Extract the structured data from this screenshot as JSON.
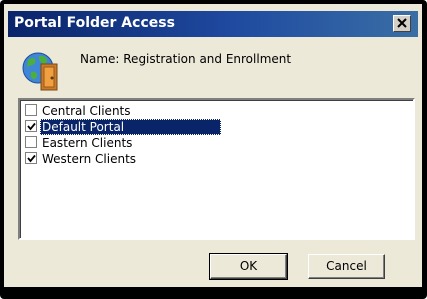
{
  "window": {
    "title": "Portal Folder Access",
    "close_glyph": "×"
  },
  "header": {
    "name_text": "Name: Registration and Enrollment",
    "icon": "globe-door-icon"
  },
  "list": {
    "items": [
      {
        "label": "Central Clients",
        "checked": false,
        "selected": false
      },
      {
        "label": "Default Portal",
        "checked": true,
        "selected": true
      },
      {
        "label": "Eastern Clients",
        "checked": false,
        "selected": false
      },
      {
        "label": "Western Clients",
        "checked": true,
        "selected": false
      }
    ]
  },
  "buttons": {
    "ok_label": "OK",
    "cancel_label": "Cancel"
  },
  "colors": {
    "titlebar": "#0a246a",
    "selection": "#0a246a",
    "dialog_bg": "#ece9d8"
  }
}
